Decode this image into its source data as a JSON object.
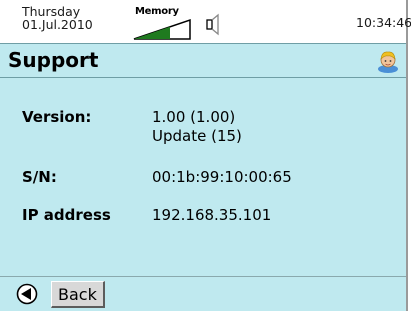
{
  "status": {
    "day": "Thursday",
    "date": "01.Jul.2010",
    "memory_label": "Memory",
    "time": "10:34:46"
  },
  "header": {
    "title": "Support",
    "help_icon": "help-avatar-icon"
  },
  "info": {
    "version_label": "Version:",
    "version_value": "1.00 (1.00)",
    "update_value": "Update (15)",
    "sn_label": "S/N:",
    "sn_value": "00:1b:99:10:00:65",
    "ip_label": "IP address",
    "ip_value": "192.168.35.101"
  },
  "footer": {
    "back_label": "Back",
    "back_icon": "back-arrow-icon"
  },
  "colors": {
    "panel": "#bfe9ef",
    "memory_fill": "#1f7a1f"
  }
}
